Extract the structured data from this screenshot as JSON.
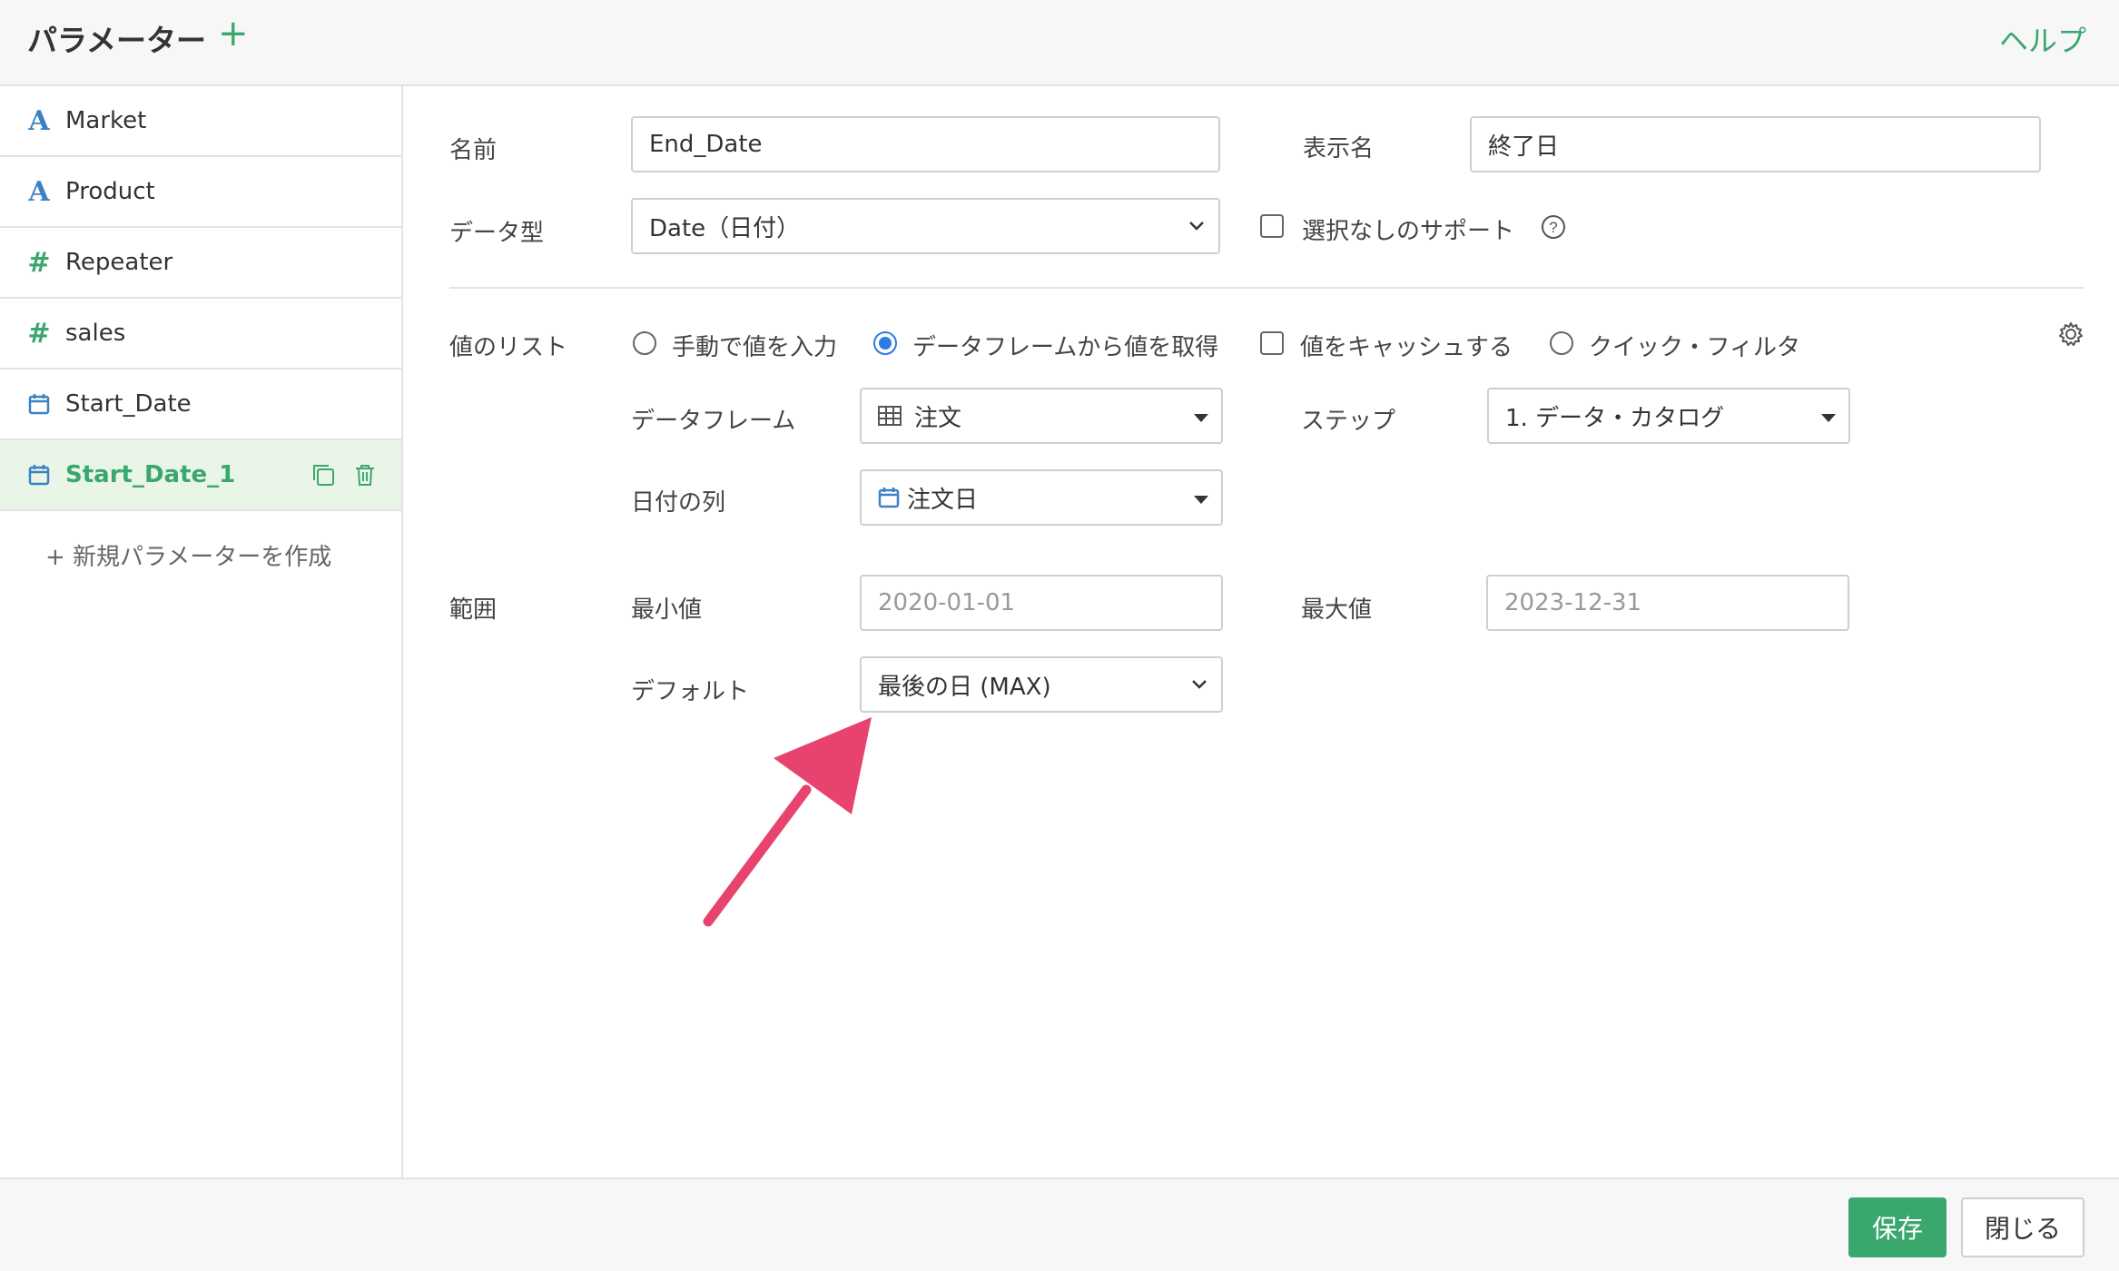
{
  "header": {
    "title": "パラメーター",
    "add_label": "+",
    "help_label": "ヘルプ"
  },
  "sidebar": {
    "items": [
      {
        "icon": "text-type-icon",
        "label": "Market"
      },
      {
        "icon": "text-type-icon",
        "label": "Product"
      },
      {
        "icon": "number-type-icon",
        "label": "Repeater"
      },
      {
        "icon": "number-type-icon",
        "label": "sales"
      },
      {
        "icon": "date-type-icon",
        "label": "Start_Date"
      },
      {
        "icon": "date-type-icon",
        "label": "Start_Date_1"
      }
    ],
    "new_param_label": "+ 新規パラメーターを作成"
  },
  "form": {
    "name_label": "名前",
    "name_value": "End_Date",
    "display_name_label": "表示名",
    "display_name_value": "終了日",
    "data_type_label": "データ型",
    "data_type_value": "Date（日付）",
    "no_selection_support_label": "選択なしのサポート",
    "value_list_label": "値のリスト",
    "value_list_options": {
      "manual": "手動で値を入力",
      "from_dataframe": "データフレームから値を取得",
      "cache": "値をキャッシュする",
      "quick_filter": "クイック・フィルタ"
    },
    "dataframe_label": "データフレーム",
    "dataframe_value": "注文",
    "step_label": "ステップ",
    "step_value": "1. データ・カタログ",
    "date_column_label": "日付の列",
    "date_column_value": "注文日",
    "range_label": "範囲",
    "min_label": "最小値",
    "min_value": "2020-01-01",
    "max_label": "最大値",
    "max_value": "2023-12-31",
    "default_label": "デフォルト",
    "default_value": "最後の日 (MAX)"
  },
  "footer": {
    "save_label": "保存",
    "close_label": "閉じる"
  },
  "colors": {
    "accent_green": "#3aa76d",
    "arrow_pink": "#e8436e",
    "radio_blue": "#2f7be6",
    "text_icon_blue": "#3b82c4"
  }
}
